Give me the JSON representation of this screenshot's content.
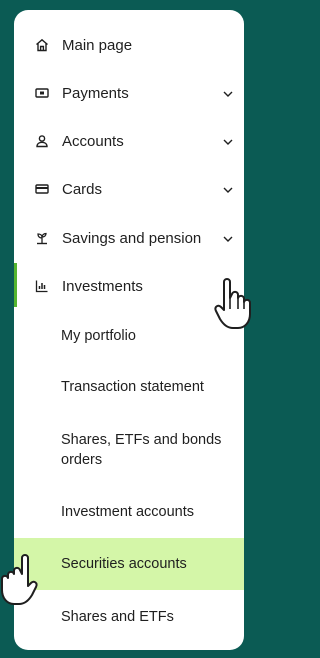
{
  "menu": {
    "items": [
      {
        "label": "Main page",
        "icon": "home-icon"
      },
      {
        "label": "Payments",
        "icon": "payment-icon",
        "chevron": true
      },
      {
        "label": "Accounts",
        "icon": "user-icon",
        "chevron": true
      },
      {
        "label": "Cards",
        "icon": "card-icon",
        "chevron": true
      },
      {
        "label": "Savings and pension",
        "icon": "savings-plant-icon",
        "chevron": true
      },
      {
        "label": "Investments",
        "icon": "chart-icon",
        "active": true
      }
    ],
    "subitems": [
      {
        "label": "My portfolio"
      },
      {
        "label": "Transaction statement"
      },
      {
        "label": "Shares, ETFs and bonds orders"
      },
      {
        "label": "Investment accounts"
      },
      {
        "label": "Securities accounts",
        "highlighted": true
      },
      {
        "label": "Shares and ETFs"
      }
    ]
  },
  "colors": {
    "background": "#0b5b54",
    "panel": "#ffffff",
    "active_accent": "#54b42f",
    "highlight": "#d4f6a8"
  }
}
